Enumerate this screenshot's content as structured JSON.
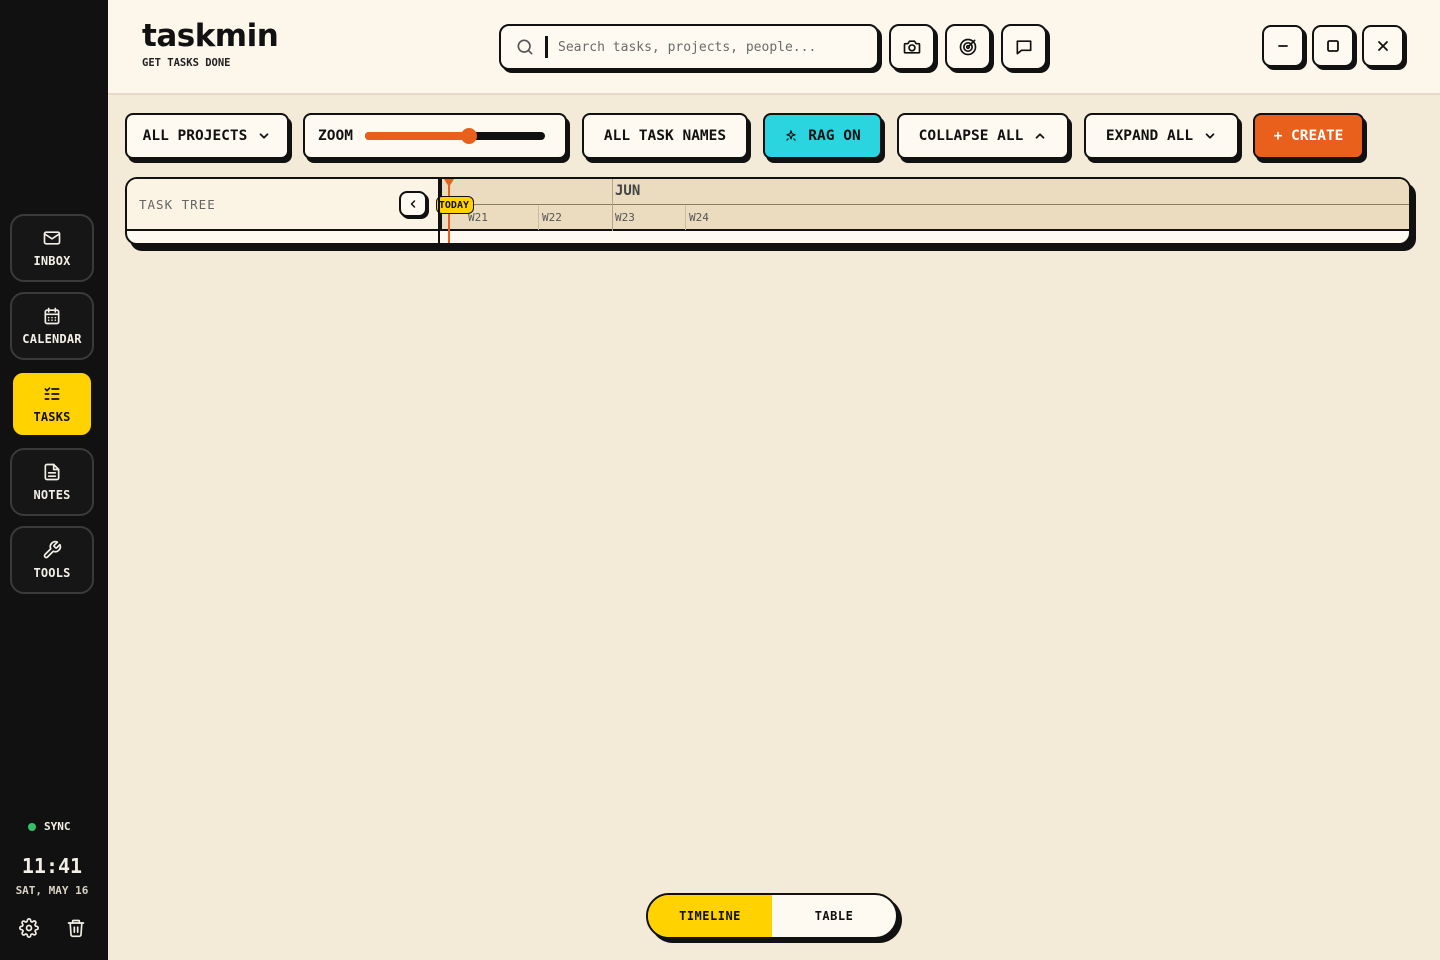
{
  "app": {
    "name": "taskmin",
    "tagline": "GET TASKS DONE"
  },
  "search": {
    "placeholder": "Search tasks, projects, people..."
  },
  "header_icons": [
    "camera-icon",
    "target-icon",
    "chat-icon"
  ],
  "window_controls": [
    "minimize-icon",
    "maximize-icon",
    "close-icon"
  ],
  "sidebar": {
    "items": [
      {
        "label": "INBOX",
        "icon": "mail-icon",
        "active": false
      },
      {
        "label": "CALENDAR",
        "icon": "calendar-icon",
        "active": false
      },
      {
        "label": "TASKS",
        "icon": "task-list-icon",
        "active": true
      },
      {
        "label": "NOTES",
        "icon": "note-icon",
        "active": false
      },
      {
        "label": "TOOLS",
        "icon": "wrench-icon",
        "active": false
      }
    ],
    "sync_label": "SYNC",
    "sync_color": "#35c16a",
    "time": "11:41",
    "date": "SAT, MAY 16",
    "footer_icons": [
      "settings-icon",
      "trash-icon"
    ]
  },
  "toolbar": {
    "projects_label": "ALL PROJECTS",
    "zoom_label": "ZOOM",
    "zoom_level": 0.58,
    "task_names_label": "ALL TASK NAMES",
    "rag_label": "RAG ON",
    "collapse_label": "COLLAPSE ALL",
    "expand_label": "EXPAND ALL",
    "create_label": "+ CREATE"
  },
  "gantt": {
    "tree_title": "TASK TREE",
    "today_label": "TODAY",
    "months": [
      "JUN"
    ],
    "weeks": [
      "W21",
      "W22",
      "W23",
      "W24"
    ]
  },
  "view_toggle": {
    "timeline_label": "TIMELINE",
    "table_label": "TABLE",
    "active": "TIMELINE"
  },
  "colors": {
    "accent_yellow": "#ffd200",
    "accent_orange": "#e8601c",
    "accent_cyan": "#2ad5df",
    "sidebar_bg": "#111111",
    "page_bg": "#f4ead8"
  }
}
